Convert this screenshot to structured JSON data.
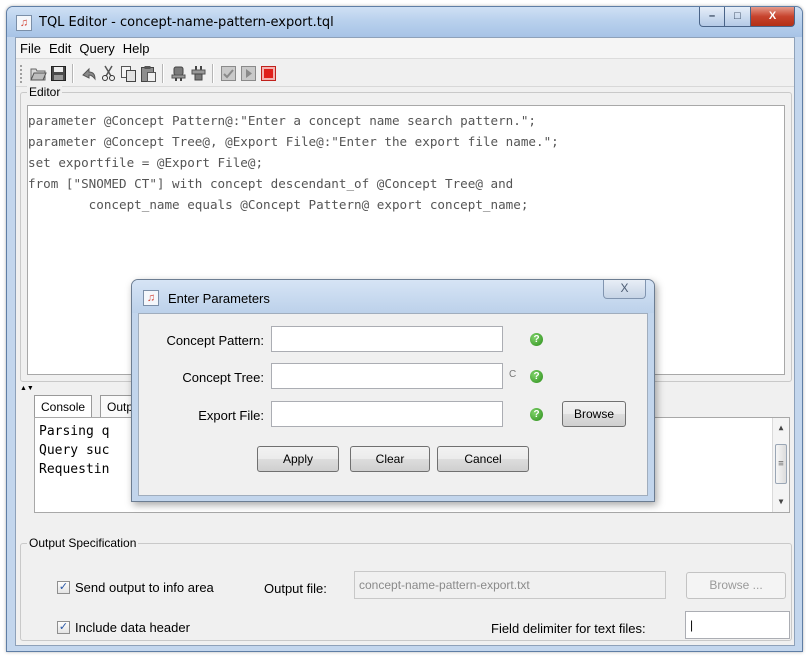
{
  "window": {
    "title": "TQL Editor -  concept-name-pattern-export.tql",
    "controls": {
      "minimize": "–",
      "maximize": "□",
      "close": "X"
    }
  },
  "menu": [
    "File",
    "Edit",
    "Query",
    "Help"
  ],
  "toolbar": {
    "icons": [
      "open-icon",
      "save-icon",
      "undo-icon",
      "cut-icon",
      "copy-icon",
      "paste-icon",
      "connect-icon",
      "disconnect-icon",
      "check-icon",
      "run-icon",
      "stop-icon"
    ],
    "stop_color": "#e0201b"
  },
  "editor": {
    "label": "Editor",
    "lines": [
      "parameter @Concept Pattern@:\"Enter a concept name search pattern.\";",
      "parameter @Concept Tree@, @Export File@:\"Enter the export file name.\";",
      "set exportfile = @Export File@;",
      "from [\"SNOMED CT\"] with concept descendant_of @Concept Tree@ and",
      "        concept_name equals @Concept Pattern@ export concept_name;"
    ]
  },
  "console": {
    "tabs": [
      "Console",
      "Outp"
    ],
    "lines": [
      "Parsing q",
      "Query suc",
      "Requestin"
    ]
  },
  "output_spec": {
    "label": "Output Specification",
    "send_output_label": "Send output to info area",
    "send_output_checked": true,
    "output_file_label": "Output file:",
    "output_file_value": "concept-name-pattern-export.txt",
    "browse_label": "Browse ...",
    "include_header_label": "Include data header",
    "include_header_checked": true,
    "delimiter_label": "Field delimiter for text files:",
    "delimiter_value": "|"
  },
  "dialog": {
    "title": "Enter Parameters",
    "close": "X",
    "fields": [
      {
        "label": "Concept Pattern:",
        "value": ""
      },
      {
        "label": "Concept Tree:",
        "value": "",
        "extra": "C"
      },
      {
        "label": "Export File:",
        "value": ""
      }
    ],
    "help_glyph": "?",
    "browse_label": "Browse",
    "apply_label": "Apply",
    "clear_label": "Clear",
    "cancel_label": "Cancel"
  }
}
